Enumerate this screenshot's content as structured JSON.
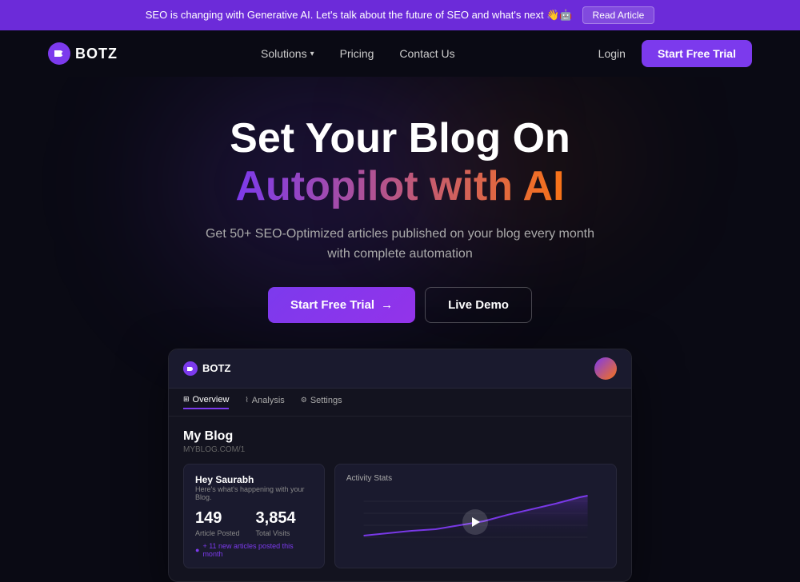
{
  "banner": {
    "text": "SEO is changing with Generative AI. Let's talk about the future of SEO and what's next 👋🤖",
    "button_label": "Read Article"
  },
  "navbar": {
    "logo_text": "BOTZ",
    "links": [
      {
        "label": "Solutions",
        "has_dropdown": true
      },
      {
        "label": "Pricing",
        "has_dropdown": false
      },
      {
        "label": "Contact Us",
        "has_dropdown": false
      }
    ],
    "login_label": "Login",
    "cta_label": "Start Free Trial"
  },
  "hero": {
    "title_line1": "Set Your Blog On",
    "title_line2": "Autopilot with AI",
    "subtitle_line1": "Get 50+ SEO-Optimized articles published on your blog every month",
    "subtitle_line2": "with complete automation",
    "btn_primary": "Start Free Trial",
    "btn_secondary": "Live Demo"
  },
  "dashboard": {
    "logo_text": "BOTZ",
    "tabs": [
      {
        "label": "Overview",
        "active": true
      },
      {
        "label": "Analysis",
        "active": false
      },
      {
        "label": "Settings",
        "active": false
      }
    ],
    "blog_title": "My Blog",
    "blog_url": "MYBLOG.COM/1",
    "greeting": "Hey Saurabh",
    "greeting_sub": "Here's what's happening with your Blog.",
    "stats": {
      "articles_posted": "149",
      "articles_label": "Article Posted",
      "total_visits": "3,854",
      "visits_label": "Total Visits",
      "footer_note": "+ 11 new articles posted this month"
    },
    "activity": {
      "title": "Activity Stats"
    }
  },
  "colors": {
    "accent_purple": "#7c3aed",
    "accent_orange": "#f97316",
    "background": "#0a0a14",
    "banner_bg": "#6c2bd9"
  }
}
